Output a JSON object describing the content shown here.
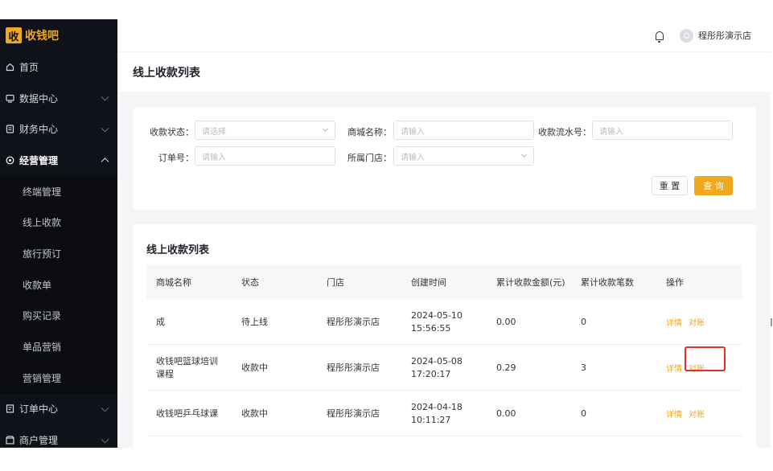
{
  "app": {
    "logo_glyph": "收",
    "logo_text": "收钱吧",
    "brand_color": "#f0a81e"
  },
  "header": {
    "store_name": "程彤彤演示店"
  },
  "sidebar": {
    "items": [
      {
        "label": "首页",
        "icon": "home-icon"
      },
      {
        "label": "数据中心",
        "icon": "monitor-icon"
      },
      {
        "label": "财务中心",
        "icon": "finance-icon"
      },
      {
        "label": "经营管理",
        "icon": "settings-circle-icon",
        "expanded": true
      }
    ],
    "sub_items": [
      {
        "label": "终端管理"
      },
      {
        "label": "线上收款"
      },
      {
        "label": "旅行预订"
      },
      {
        "label": "收款单"
      },
      {
        "label": "购买记录"
      },
      {
        "label": "单品营销"
      },
      {
        "label": "营销管理"
      }
    ],
    "bottom_items": [
      {
        "label": "订单中心",
        "icon": "order-icon"
      },
      {
        "label": "商户管理",
        "icon": "merchant-icon"
      }
    ]
  },
  "page": {
    "title": "线上收款列表"
  },
  "filters": {
    "status_label": "收款状态：",
    "status_placeholder": "请选择",
    "mall_label": "商城名称：",
    "mall_placeholder": "请输入",
    "serial_label": "收款流水号：",
    "serial_placeholder": "请输入",
    "order_label": "订单号：",
    "order_placeholder": "请输入",
    "store_label": "所属门店：",
    "store_placeholder": "请输入",
    "reset_label": "重 置",
    "query_label": "查 询"
  },
  "table": {
    "title": "线上收款列表",
    "headers": [
      "商城名称",
      "状态",
      "门店",
      "创建时间",
      "累计收款金额(元)",
      "累计收款笔数",
      "操作"
    ],
    "rows": [
      {
        "name": "成",
        "status": "待上线",
        "store": "程彤彤演示店",
        "date": "2024-05-10",
        "time": "15:56:55",
        "amount": "0.00",
        "count": "0",
        "detail": "详情",
        "reconcile": "对账"
      },
      {
        "name": "收钱吧篮球培训课程",
        "status": "收款中",
        "store": "程彤彤演示店",
        "date": "2024-05-08",
        "time": "17:20:17",
        "amount": "0.29",
        "count": "3",
        "detail": "详情",
        "reconcile": "对账"
      },
      {
        "name": "收钱吧乒乓球课",
        "status": "收款中",
        "store": "程彤彤演示店",
        "date": "2024-04-18",
        "time": "10:11:27",
        "amount": "0.00",
        "count": "0",
        "detail": "详情",
        "reconcile": "对账"
      }
    ]
  }
}
